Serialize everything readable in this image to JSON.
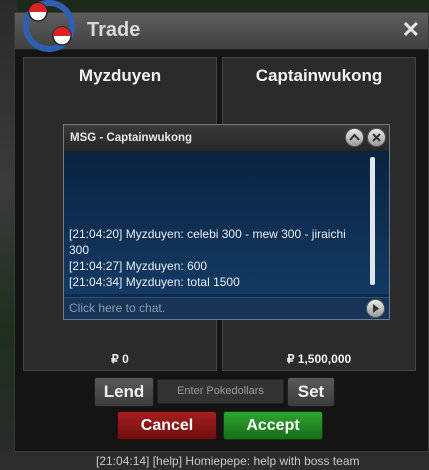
{
  "window": {
    "title": "Trade"
  },
  "trade": {
    "left_player": "Myzduyen",
    "right_player": "Captainwukong",
    "left_money": "₽ 0",
    "right_money": "₽ 1,500,000"
  },
  "chat": {
    "title": "MSG - Captainwukong",
    "messages": [
      "[21:04:20] Myzduyen: celebi 300 - mew 300 - jiraichi 300",
      "[21:04:27] Myzduyen: 600",
      "[21:04:34] Myzduyen: total 1500"
    ],
    "input_placeholder": "Click here to chat."
  },
  "controls": {
    "lend_label": "Lend",
    "money_placeholder": "Enter Pokedollars",
    "set_label": "Set",
    "cancel_label": "Cancel",
    "accept_label": "Accept"
  },
  "background": {
    "chat_line": "[21:04:14] [help] Homiepepe: help with boss team"
  },
  "colors": {
    "cancel": "#8b1616",
    "accept": "#229322",
    "chat_bg": "#0f2a4a"
  }
}
